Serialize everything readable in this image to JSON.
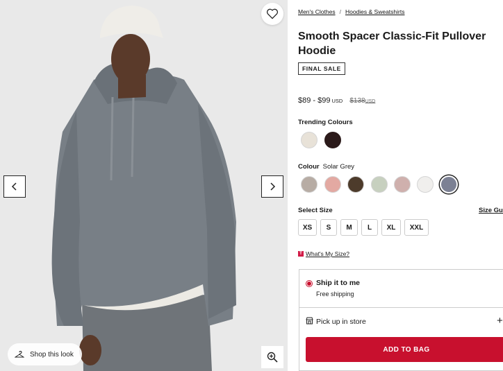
{
  "breadcrumb": {
    "item1": "Men's Clothes",
    "separator": "/",
    "item2": "Hoodies & Sweatshirts"
  },
  "product": {
    "title": "Smooth Spacer Classic-Fit Pullover Hoodie",
    "badge": "FINAL SALE",
    "price_range": "$89 - $99",
    "price_currency": "USD",
    "original_price": "$138",
    "original_currency": "USD"
  },
  "trending": {
    "label": "Trending Colours",
    "swatches": [
      {
        "name": "cream-swatch",
        "color": "#e8e2d8"
      },
      {
        "name": "dark-brown-swatch",
        "color": "#2b1a1a"
      }
    ]
  },
  "colour": {
    "label": "Colour",
    "selected": "Solar Grey",
    "swatches": [
      {
        "name": "taupe-heather-swatch",
        "color": "#b7aca4"
      },
      {
        "name": "pink-swatch",
        "color": "#e3a9a2"
      },
      {
        "name": "espresso-swatch",
        "color": "#4d3b2b"
      },
      {
        "name": "sage-swatch",
        "color": "#c7d0bf"
      },
      {
        "name": "dusty-rose-swatch",
        "color": "#cfb0ad"
      },
      {
        "name": "white-swatch",
        "color": "#f0efed"
      },
      {
        "name": "solar-grey-swatch",
        "color": "#7c8194"
      }
    ]
  },
  "size": {
    "label": "Select Size",
    "guide": "Size Guide",
    "options": [
      "XS",
      "S",
      "M",
      "L",
      "XL",
      "XXL"
    ]
  },
  "whats_my_size": {
    "icon_text": "T",
    "label": "What's My Size?"
  },
  "delivery": {
    "ship_title": "Ship it to me",
    "ship_sub": "Free shipping",
    "pickup_title": "Pick up in store",
    "plus": "+"
  },
  "cta": {
    "add_to_bag": "ADD TO BAG"
  },
  "image": {
    "shop_look": "Shop this look",
    "colors": {
      "background": "#e9e9e9",
      "hoodie": "#787f86",
      "cap": "#efede8",
      "skin": "#5a3a2a"
    }
  },
  "accent": "#c8102e"
}
